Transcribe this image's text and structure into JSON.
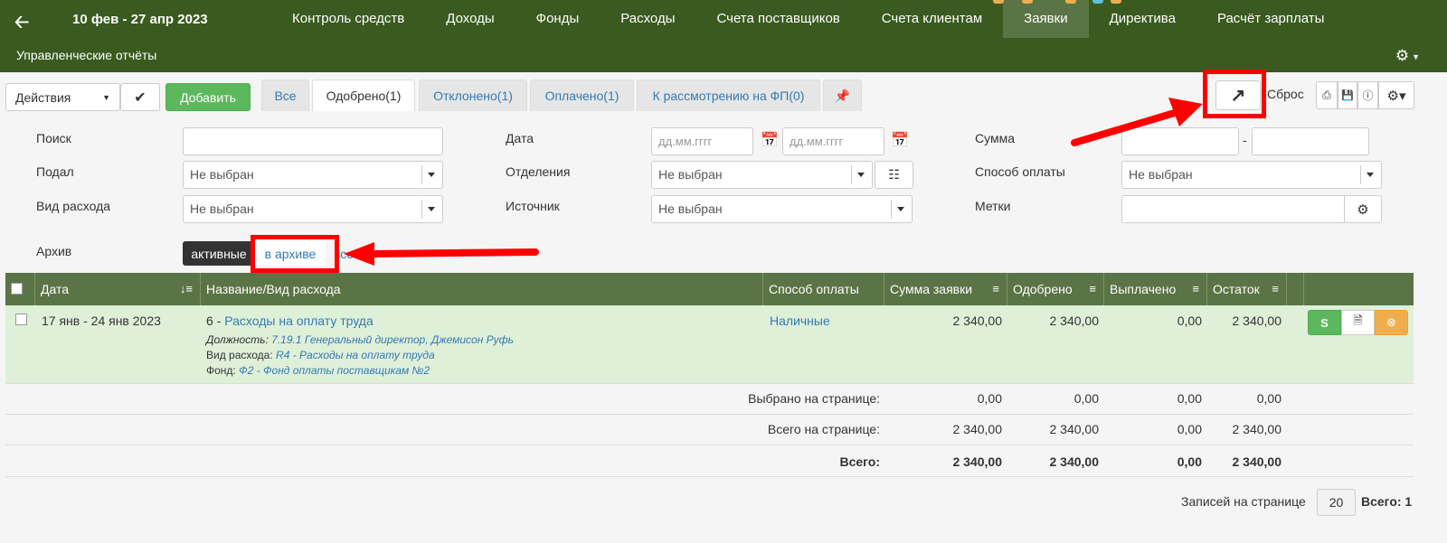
{
  "header": {
    "date_range": "10 фев - 27 апр 2023",
    "nav": [
      "Контроль средств",
      "Доходы",
      "Фонды",
      "Расходы",
      "Счета поставщиков",
      "Счета клиентам",
      "Заявки",
      "Директива",
      "Расчёт зарплаты"
    ],
    "active_nav": "Заявки",
    "subnav": "Управленческие отчёты"
  },
  "toolbar": {
    "actions_label": "Действия",
    "add_label": "Добавить",
    "tabs": [
      "Все",
      "Одобрено(1)",
      "Отклонено(1)",
      "Оплачено(1)",
      "К рассмотрению на ФП(0)"
    ],
    "active_tab": "Одобрено(1)",
    "reset_label": "Сброс"
  },
  "filters": {
    "search_label": "Поиск",
    "date_label": "Дата",
    "date_from_placeholder": "дд.мм.гггг",
    "date_to_placeholder": "дд.мм.гггг",
    "sum_label": "Сумма",
    "sum_sep": "-",
    "submitted_label": "Подал",
    "submitted_value": "Не выбран",
    "departments_label": "Отделения",
    "departments_value": "Не выбран",
    "payment_label": "Способ оплаты",
    "payment_value": "Не выбран",
    "expense_type_label": "Вид расхода",
    "expense_type_value": "Не выбран",
    "source_label": "Источник",
    "source_value": "Не выбран",
    "tags_label": "Метки",
    "archive_label": "Архив",
    "archive_active": "активные",
    "archive_archived": "в архиве",
    "archive_all": "все"
  },
  "table": {
    "headers": [
      "Дата",
      "Название/Вид расхода",
      "Способ оплаты",
      "Сумма заявки",
      "Одобрено",
      "Выплачено",
      "Остаток"
    ],
    "row": {
      "date": "17 янв - 24 янв 2023",
      "num": "6 - ",
      "title": "Расходы на оплату труда",
      "position_label": "Должность:",
      "position_value": "7.19.1 Генеральный директор, Джемисон Руфь",
      "expense_label": "Вид расхода:",
      "expense_value": "R4 - Расходы на оплату труда",
      "fund_label": "Фонд:",
      "fund_value": "Ф2 - Фонд оплаты поставщикам №2",
      "payment": "Наличные",
      "amount": "2 340,00",
      "approved": "2 340,00",
      "paid": "0,00",
      "rest": "2 340,00",
      "pay_btn": "S"
    },
    "selected_label": "Выбрано на странице:",
    "selected": [
      "0,00",
      "0,00",
      "0,00",
      "0,00"
    ],
    "page_total_label": "Всего на странице:",
    "page_total": [
      "2 340,00",
      "2 340,00",
      "0,00",
      "2 340,00"
    ],
    "total_label": "Всего:",
    "total": [
      "2 340,00",
      "2 340,00",
      "0,00",
      "2 340,00"
    ]
  },
  "footer": {
    "per_page_label": "Записей на странице",
    "per_page": "20",
    "total_count": "Всего: 1"
  },
  "colors": {
    "header_bg": "#3a5a1f",
    "table_head": "#5a7445",
    "row_bg": "#dff0d8",
    "annotation": "#ff0000"
  }
}
